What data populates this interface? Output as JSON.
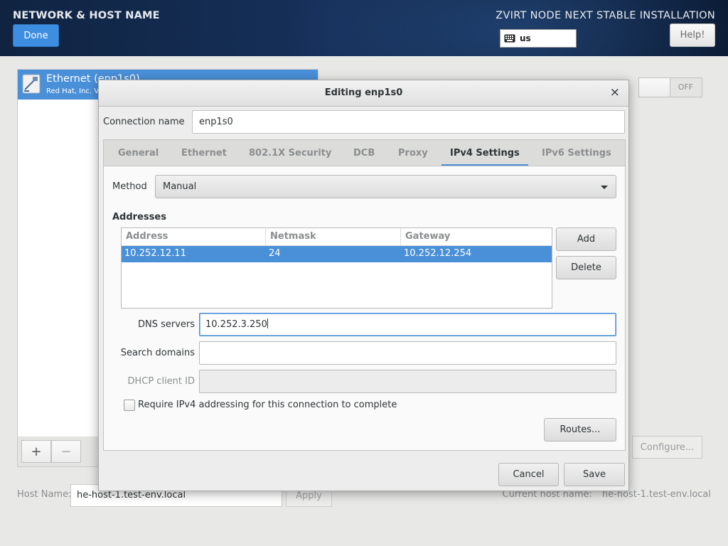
{
  "header": {
    "title": "NETWORK & HOST NAME",
    "done_label": "Done",
    "product": "ZVIRT NODE NEXT STABLE INSTALLATION",
    "keyboard_layout": "us",
    "help_label": "Help!"
  },
  "interfaces": [
    {
      "name": "Ethernet (enp1s0)",
      "vendor": "Red Hat, Inc. V"
    }
  ],
  "list_toolbar": {
    "add": "+",
    "remove": "−"
  },
  "toggle": {
    "state": "OFF"
  },
  "configure_label": "Configure...",
  "hostname": {
    "label": "Host Name:",
    "value": "he-host-1.test-env.local",
    "apply_label": "Apply",
    "current_label": "Current host name:",
    "current_value": "he-host-1.test-env.local"
  },
  "dialog": {
    "title": "Editing enp1s0",
    "close": "×",
    "connection_name_label": "Connection name",
    "connection_name": "enp1s0",
    "tabs": [
      {
        "label": "General"
      },
      {
        "label": "Ethernet"
      },
      {
        "label": "802.1X Security"
      },
      {
        "label": "DCB"
      },
      {
        "label": "Proxy"
      },
      {
        "label": "IPv4 Settings",
        "active": true
      },
      {
        "label": "IPv6 Settings"
      }
    ],
    "ipv4": {
      "method_label": "Method",
      "method": "Manual",
      "addresses_title": "Addresses",
      "columns": [
        "Address",
        "Netmask",
        "Gateway"
      ],
      "rows": [
        {
          "address": "10.252.12.11",
          "netmask": "24",
          "gateway": "10.252.12.254"
        }
      ],
      "add_label": "Add",
      "delete_label": "Delete",
      "dns_label": "DNS servers",
      "dns_value": "10.252.3.250",
      "search_label": "Search domains",
      "search_value": "",
      "dhcp_label": "DHCP client ID",
      "dhcp_value": "",
      "require_label": "Require IPv4 addressing for this connection to complete",
      "require_checked": false,
      "routes_label": "Routes..."
    },
    "cancel_label": "Cancel",
    "save_label": "Save"
  },
  "colors": {
    "accent": "#4a90d9",
    "done_button": "#3d8de0",
    "header_bg": "#16305a"
  }
}
